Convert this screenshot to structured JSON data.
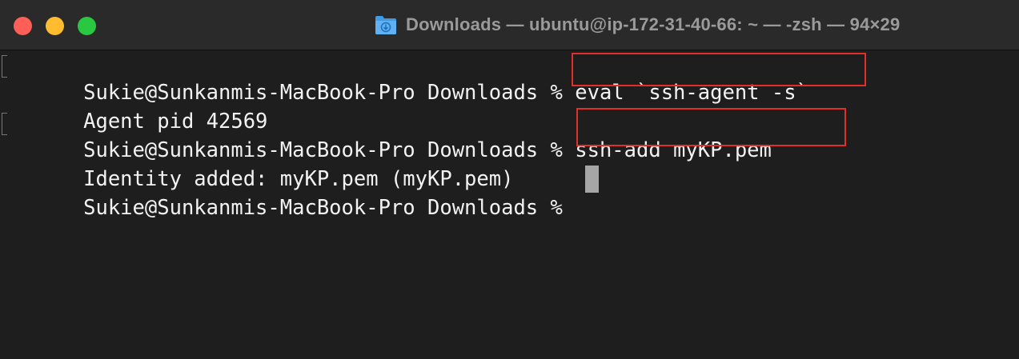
{
  "window": {
    "title": "Downloads — ubuntu@ip-172-31-40-66: ~ — -zsh — 94×29",
    "colors": {
      "close": "#ff5f57",
      "minimize": "#febc2e",
      "maximize": "#28c840"
    }
  },
  "terminal": {
    "prompt": "Sukie@Sunkanmis-MacBook-Pro Downloads %",
    "lines": [
      {
        "prompt": "Sukie@Sunkanmis-MacBook-Pro Downloads %",
        "command": "eval `ssh-agent -s`"
      },
      {
        "output": "Agent pid 42569"
      },
      {
        "prompt": "Sukie@Sunkanmis-MacBook-Pro Downloads %",
        "command": "ssh-add myKP.pem"
      },
      {
        "output": "Identity added: myKP.pem (myKP.pem)"
      },
      {
        "prompt": "Sukie@Sunkanmis-MacBook-Pro Downloads %",
        "command": ""
      }
    ],
    "highlight_color": "#e0302a"
  }
}
